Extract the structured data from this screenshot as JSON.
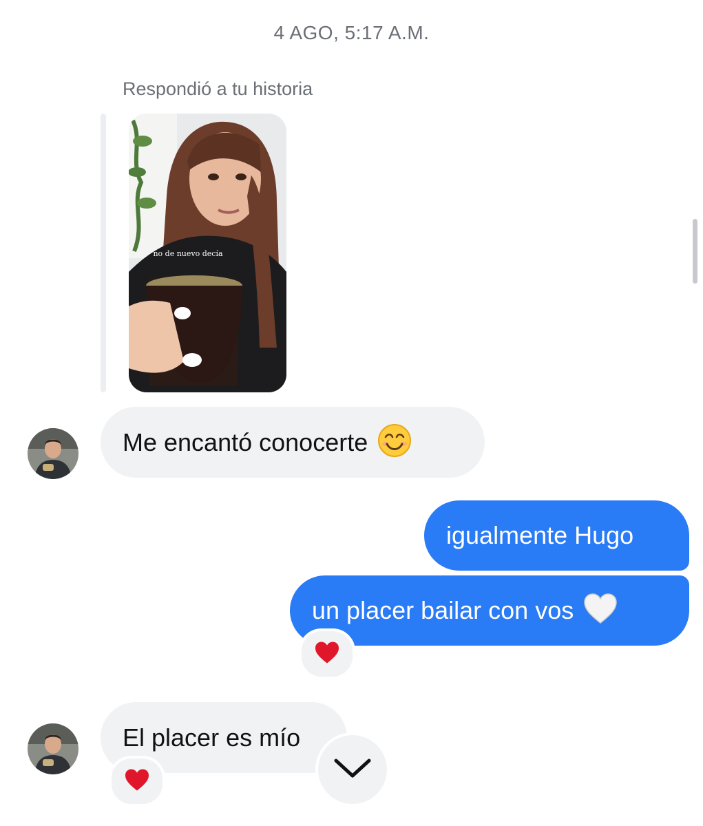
{
  "conversation": {
    "timestamp": "4 AGO, 5:17 A.M.",
    "story_reply": {
      "caption": "Respondió a tu historia",
      "story_text": "no de nuevo decía"
    },
    "messages": [
      {
        "sender": "them",
        "text": "Me encantó conocerte",
        "emoji": "smiling-face-icon"
      },
      {
        "sender": "me",
        "text": "igualmente Hugo"
      },
      {
        "sender": "me",
        "text": "un placer bailar con vos",
        "emoji": "white-heart-icon",
        "reaction": "red-heart-icon"
      },
      {
        "sender": "them",
        "text": "El placer es mío",
        "reaction": "red-heart-icon"
      }
    ]
  },
  "colors": {
    "outgoing_bubble": "#2a7bf6",
    "incoming_bubble": "#f1f2f4",
    "meta_text": "#6b6f75",
    "reaction_heart": "#e0162b"
  },
  "controls": {
    "scroll_down_icon": "chevron-down-icon"
  }
}
